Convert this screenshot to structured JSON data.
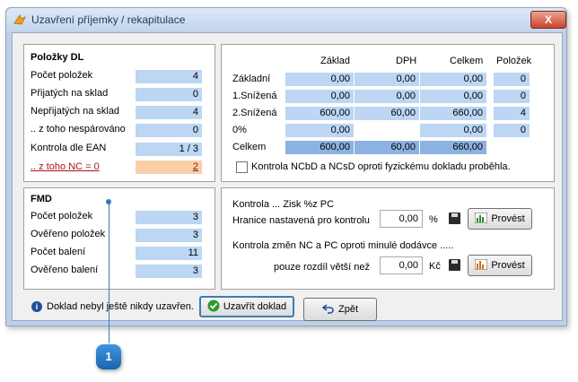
{
  "window": {
    "title": "Uzavření příjemky / rekapitulace",
    "close_label": "X"
  },
  "dl": {
    "title": "Položky DL",
    "rows": [
      {
        "label": "Počet položek",
        "value": "4"
      },
      {
        "label": "Přijatých na sklad",
        "value": "0"
      },
      {
        "label": "Nepřijatých na sklad",
        "value": "4"
      },
      {
        "label": ".. z toho nespárováno",
        "value": "0"
      },
      {
        "label": "Kontrola dle EAN",
        "value": "1 / 3"
      }
    ],
    "nc_label": ".. z toho NC = 0",
    "nc_value": "2"
  },
  "fmd": {
    "title": "FMD",
    "rows": [
      {
        "label": "Počet položek",
        "value": "3"
      },
      {
        "label": "Ověřeno položek",
        "value": "3"
      },
      {
        "label": "Počet balení",
        "value": "11"
      },
      {
        "label": "Ověřeno balení",
        "value": "3"
      }
    ]
  },
  "vat": {
    "headers": {
      "zaklad": "Základ",
      "dph": "DPH",
      "celkem": "Celkem",
      "polozek": "Položek"
    },
    "rows": [
      {
        "label": "Základní",
        "zaklad": "0,00",
        "dph": "0,00",
        "celkem": "0,00",
        "polozek": "0"
      },
      {
        "label": "1.Snížená",
        "zaklad": "0,00",
        "dph": "0,00",
        "celkem": "0,00",
        "polozek": "0"
      },
      {
        "label": "2.Snížená",
        "zaklad": "600,00",
        "dph": "60,00",
        "celkem": "660,00",
        "polozek": "4"
      },
      {
        "label": "0%",
        "zaklad": "0,00",
        "dph": "",
        "celkem": "0,00",
        "polozek": "0"
      }
    ],
    "total": {
      "label": "Celkem",
      "zaklad": "600,00",
      "dph": "60,00",
      "celkem": "660,00"
    },
    "checkbox_label": "Kontrola NCbD a NCsD oproti fyzickému dokladu proběhla."
  },
  "control": {
    "title": "Kontrola ... Zisk %z PC",
    "limit_label": "Hranice nastavená pro kontrolu",
    "limit_value": "0,00",
    "limit_unit": "%",
    "run_label": "Provést",
    "change_title": "Kontrola změn NC a PC oproti minulé dodávce  .....",
    "diff_label": "pouze rozdíl větší než",
    "diff_value": "0,00",
    "diff_unit": "Kč"
  },
  "footer": {
    "info": "Doklad nebyl ještě nikdy uzavřen.",
    "close_doc": "Uzavřít doklad",
    "back": "Zpět"
  },
  "callout": "1"
}
